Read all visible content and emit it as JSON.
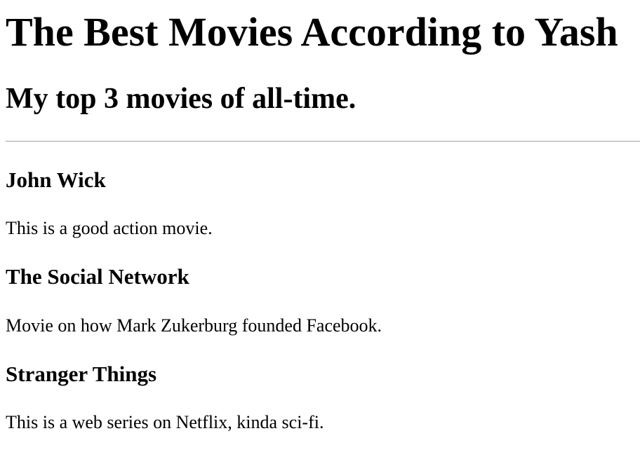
{
  "page": {
    "title": "The Best Movies According to Yash",
    "subtitle": "My top 3 movies of all-time."
  },
  "movies": [
    {
      "title": "John Wick",
      "description": "This is a good action movie."
    },
    {
      "title": "The Social Network",
      "description": "Movie on how Mark Zukerburg founded Facebook."
    },
    {
      "title": "Stranger Things",
      "description": "This is a web series on Netflix, kinda sci-fi."
    }
  ]
}
